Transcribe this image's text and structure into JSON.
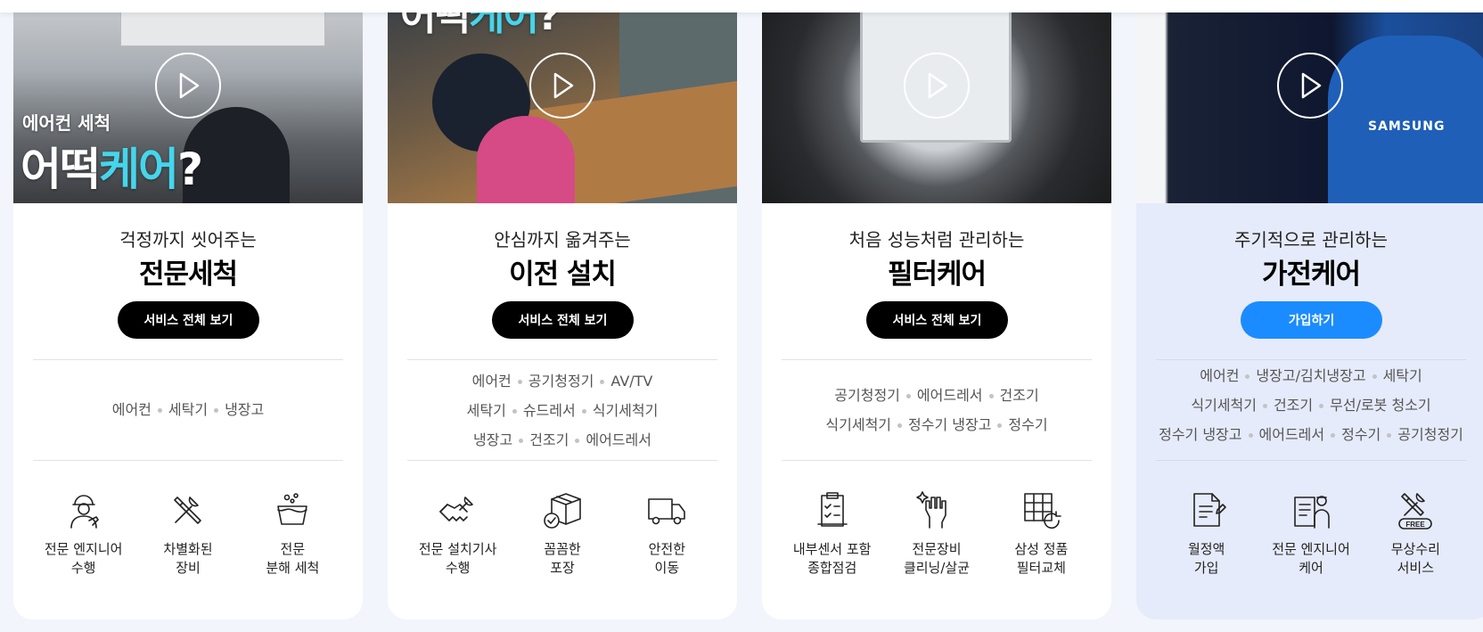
{
  "cards": [
    {
      "thumb_overlay": {
        "small": "에어컨 세척",
        "big_pre": "어떡",
        "big_accent": "케어",
        "big_post": "?"
      },
      "subtitle": "걱정까지 씻어주는",
      "title": "전문세척",
      "button": "서비스 전체 보기",
      "appliance_lines": [
        [
          "에어컨",
          "세탁기",
          "냉장고"
        ]
      ],
      "features": [
        {
          "icon": "engineer-icon",
          "label": "전문 엔지니어\n수행"
        },
        {
          "icon": "tools-icon",
          "label": "차별화된\n장비"
        },
        {
          "icon": "wash-basin-icon",
          "label": "전문\n분해 세척"
        }
      ]
    },
    {
      "thumb_overlay": {
        "big_pre": "어떡",
        "big_accent": "케어",
        "big_post": "?"
      },
      "subtitle": "안심까지 옮겨주는",
      "title": "이전 설치",
      "button": "서비스 전체 보기",
      "appliance_lines": [
        [
          "에어컨",
          "공기청정기",
          "AV/TV"
        ],
        [
          "세탁기",
          "슈드레서",
          "식기세척기"
        ],
        [
          "냉장고",
          "건조기",
          "에어드레서"
        ]
      ],
      "features": [
        {
          "icon": "handshake-wrench-icon",
          "label": "전문 설치기사\n수행"
        },
        {
          "icon": "package-check-icon",
          "label": "꼼꼼한\n포장"
        },
        {
          "icon": "truck-icon",
          "label": "안전한\n이동"
        }
      ]
    },
    {
      "subtitle": "처음 성능처럼 관리하는",
      "title": "필터케어",
      "button": "서비스 전체 보기",
      "appliance_lines": [
        [
          "공기청정기",
          "에어드레서",
          "건조기"
        ],
        [
          "식기세척기",
          "정수기 냉장고",
          "정수기"
        ]
      ],
      "features": [
        {
          "icon": "clipboard-check-icon",
          "label": "내부센서 포함\n종합점검"
        },
        {
          "icon": "cleaning-glove-icon",
          "label": "전문장비\n클리닝/살균"
        },
        {
          "icon": "filter-replace-icon",
          "label": "삼성 정품\n필터교체"
        }
      ]
    },
    {
      "thumb_overlay": {
        "patch": "SAMSUNG"
      },
      "subtitle": "주기적으로 관리하는",
      "title": "가전케어",
      "button": "가입하기",
      "appliance_lines": [
        [
          "에어컨",
          "냉장고/김치냉장고",
          "세탁기"
        ],
        [
          "식기세척기",
          "건조기",
          "무선/로봇 청소기"
        ],
        [
          "정수기 냉장고",
          "에어드레서",
          "정수기",
          "공기청정기"
        ]
      ],
      "features": [
        {
          "icon": "contract-pen-icon",
          "label": "월정액\n가입"
        },
        {
          "icon": "engineer-document-icon",
          "label": "전문 엔지니어\n케어"
        },
        {
          "icon": "free-repair-icon",
          "label": "무상수리\n서비스",
          "badge": "FREE"
        }
      ]
    }
  ],
  "colors": {
    "accent_blue": "#1b8cff",
    "highlight_card_bg": "#e6ebfb",
    "overlay_cyan": "#44d6ec"
  }
}
